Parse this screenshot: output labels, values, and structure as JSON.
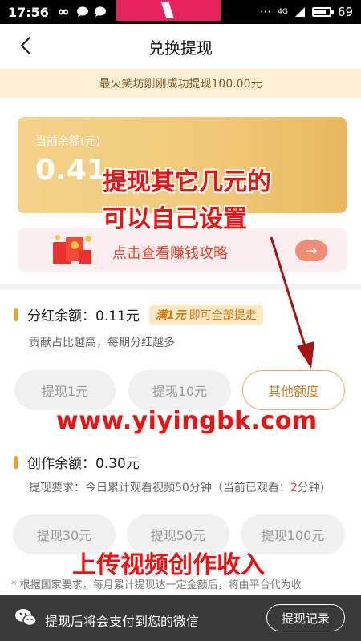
{
  "status_bar": {
    "time": "17:56",
    "battery": "69",
    "signal": "4G"
  },
  "header": {
    "title": "兑换提现"
  },
  "notice": {
    "text": "最火笑坊刚刚成功提现100.00元"
  },
  "balance": {
    "label": "当前余额(元)",
    "amount": "0.41"
  },
  "guide": {
    "text": "点击查看赚钱攻略",
    "arrow": "→"
  },
  "dividend": {
    "label": "分红余额：0.11元",
    "pill_strong": "满1元",
    "pill_rest": "即可全部提走",
    "desc": "贡献占比越高，每期分红越多",
    "buttons": [
      "提现1元",
      "提现10元",
      "其他额度"
    ]
  },
  "creation": {
    "label": "创作余额：0.30元",
    "desc_before": "提现要求：今日累计观看视频50分钟（当前已观看：",
    "desc_value": "2",
    "desc_after": "分钟)",
    "buttons": [
      "提现30元",
      "提现50元",
      "提现100元"
    ]
  },
  "footnote": {
    "text": "* 根据国家要求，每月累计提现达一定金额后，将由平台代为收"
  },
  "bottom_bar": {
    "hint": "提现后将会支付到您的微信",
    "record_button": "提现记录"
  },
  "annotations": {
    "line1": "提现其它几元的",
    "line2": "可以自己设置",
    "url": "www.yiyingbk.com",
    "bottom": "上传视频创作收入"
  },
  "colors": {
    "accent_orange": "#f2a21a",
    "annotation_red": "#f01010",
    "card_gold": "#f1c877"
  }
}
